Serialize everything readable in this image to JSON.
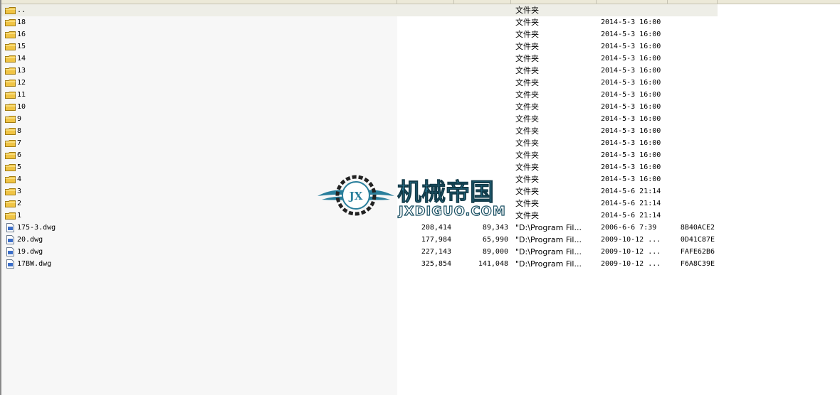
{
  "rows": [
    {
      "kind": "folder",
      "icon": "folder-icon",
      "name": "..",
      "size": "",
      "packed": "",
      "type": "文件夹",
      "modified": "",
      "crc": ""
    },
    {
      "kind": "folder",
      "icon": "folder-icon",
      "name": "18",
      "size": "",
      "packed": "",
      "type": "文件夹",
      "modified": "2014-5-3 16:00",
      "crc": ""
    },
    {
      "kind": "folder",
      "icon": "folder-icon",
      "name": "16",
      "size": "",
      "packed": "",
      "type": "文件夹",
      "modified": "2014-5-3 16:00",
      "crc": ""
    },
    {
      "kind": "folder",
      "icon": "folder-icon",
      "name": "15",
      "size": "",
      "packed": "",
      "type": "文件夹",
      "modified": "2014-5-3 16:00",
      "crc": ""
    },
    {
      "kind": "folder",
      "icon": "folder-icon",
      "name": "14",
      "size": "",
      "packed": "",
      "type": "文件夹",
      "modified": "2014-5-3 16:00",
      "crc": ""
    },
    {
      "kind": "folder",
      "icon": "folder-icon",
      "name": "13",
      "size": "",
      "packed": "",
      "type": "文件夹",
      "modified": "2014-5-3 16:00",
      "crc": ""
    },
    {
      "kind": "folder",
      "icon": "folder-icon",
      "name": "12",
      "size": "",
      "packed": "",
      "type": "文件夹",
      "modified": "2014-5-3 16:00",
      "crc": ""
    },
    {
      "kind": "folder",
      "icon": "folder-icon",
      "name": "11",
      "size": "",
      "packed": "",
      "type": "文件夹",
      "modified": "2014-5-3 16:00",
      "crc": ""
    },
    {
      "kind": "folder",
      "icon": "folder-icon",
      "name": "10",
      "size": "",
      "packed": "",
      "type": "文件夹",
      "modified": "2014-5-3 16:00",
      "crc": ""
    },
    {
      "kind": "folder",
      "icon": "folder-icon",
      "name": "9",
      "size": "",
      "packed": "",
      "type": "文件夹",
      "modified": "2014-5-3 16:00",
      "crc": ""
    },
    {
      "kind": "folder",
      "icon": "folder-icon",
      "name": "8",
      "size": "",
      "packed": "",
      "type": "文件夹",
      "modified": "2014-5-3 16:00",
      "crc": ""
    },
    {
      "kind": "folder",
      "icon": "folder-icon",
      "name": "7",
      "size": "",
      "packed": "",
      "type": "文件夹",
      "modified": "2014-5-3 16:00",
      "crc": ""
    },
    {
      "kind": "folder",
      "icon": "folder-icon",
      "name": "6",
      "size": "",
      "packed": "",
      "type": "文件夹",
      "modified": "2014-5-3 16:00",
      "crc": ""
    },
    {
      "kind": "folder",
      "icon": "folder-icon",
      "name": "5",
      "size": "",
      "packed": "",
      "type": "文件夹",
      "modified": "2014-5-3 16:00",
      "crc": ""
    },
    {
      "kind": "folder",
      "icon": "folder-icon",
      "name": "4",
      "size": "",
      "packed": "",
      "type": "文件夹",
      "modified": "2014-5-3 16:00",
      "crc": ""
    },
    {
      "kind": "folder",
      "icon": "folder-icon",
      "name": "3",
      "size": "",
      "packed": "",
      "type": "文件夹",
      "modified": "2014-5-6 21:14",
      "crc": ""
    },
    {
      "kind": "folder",
      "icon": "folder-icon",
      "name": "2",
      "size": "",
      "packed": "",
      "type": "文件夹",
      "modified": "2014-5-6 21:14",
      "crc": ""
    },
    {
      "kind": "folder",
      "icon": "folder-icon",
      "name": "1",
      "size": "",
      "packed": "",
      "type": "文件夹",
      "modified": "2014-5-6 21:14",
      "crc": ""
    },
    {
      "kind": "file",
      "icon": "dwg-file-icon",
      "name": "175-3.dwg",
      "size": "208,414",
      "packed": "89,343",
      "type": "\"D:\\Program Fil...",
      "modified": "2006-6-6 7:39",
      "crc": "8B40ACE2"
    },
    {
      "kind": "file",
      "icon": "dwg-file-icon",
      "name": "20.dwg",
      "size": "177,984",
      "packed": "65,990",
      "type": "\"D:\\Program Fil...",
      "modified": "2009-10-12 ...",
      "crc": "0D41C87E"
    },
    {
      "kind": "file",
      "icon": "dwg-file-icon",
      "name": "19.dwg",
      "size": "227,143",
      "packed": "89,000",
      "type": "\"D:\\Program Fil...",
      "modified": "2009-10-12 ...",
      "crc": "FAFE62B6"
    },
    {
      "kind": "file",
      "icon": "dwg-file-icon",
      "name": "17BW.dwg",
      "size": "325,854",
      "packed": "141,048",
      "type": "\"D:\\Program Fil...",
      "modified": "2009-10-12 ...",
      "crc": "F6A8C39E"
    }
  ],
  "watermark": {
    "icon": "gear-wings-logo-icon",
    "badge": "JX",
    "title": "机械帝国",
    "url": "JXDIGUO.COM"
  },
  "colors": {
    "folder": "#f0c445",
    "selected_row": "#eeeee7",
    "name_column_bg": "#f7f7f7",
    "watermark_primary": "#2a7f9c"
  }
}
